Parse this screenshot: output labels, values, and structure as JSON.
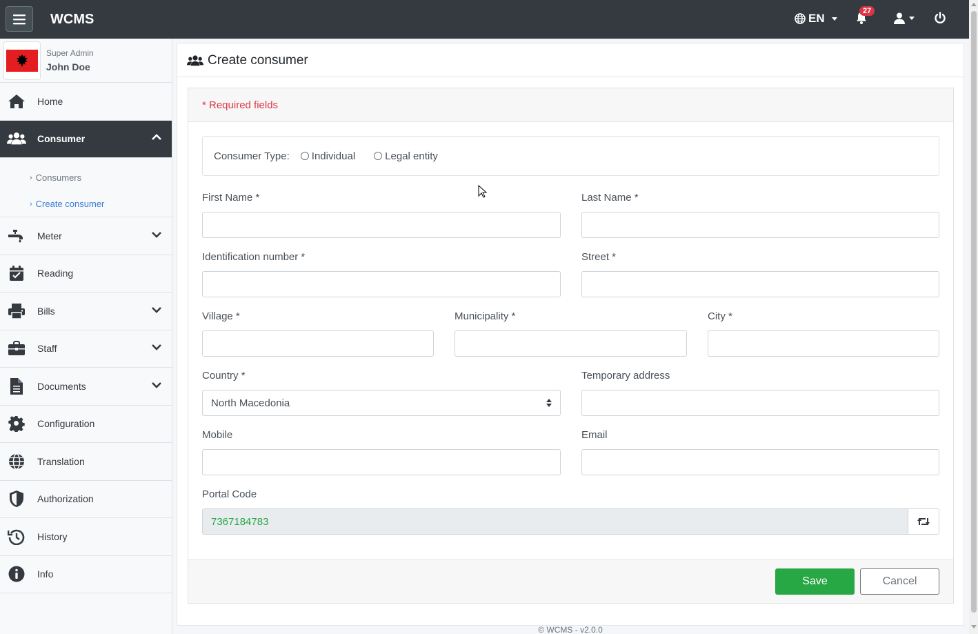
{
  "app": {
    "brand": "WCMS"
  },
  "navbar": {
    "language": "EN",
    "notifications_count": "27"
  },
  "user": {
    "role": "Super Admin",
    "name": "John Doe"
  },
  "sidebar": {
    "items": [
      {
        "label": "Home",
        "icon": "home-icon"
      },
      {
        "label": "Consumer",
        "icon": "users-icon",
        "active": true
      },
      {
        "label": "Meter",
        "icon": "faucet-icon"
      },
      {
        "label": "Reading",
        "icon": "calendar-check-icon"
      },
      {
        "label": "Bills",
        "icon": "printer-icon"
      },
      {
        "label": "Staff",
        "icon": "briefcase-icon"
      },
      {
        "label": "Documents",
        "icon": "document-icon"
      },
      {
        "label": "Configuration",
        "icon": "gear-icon"
      },
      {
        "label": "Translation",
        "icon": "globe-icon"
      },
      {
        "label": "Authorization",
        "icon": "shield-icon"
      },
      {
        "label": "History",
        "icon": "history-icon"
      },
      {
        "label": "Info",
        "icon": "info-icon"
      }
    ],
    "subitems": [
      {
        "label": "Consumers"
      },
      {
        "label": "Create consumer"
      }
    ]
  },
  "page": {
    "title": "Create consumer"
  },
  "form": {
    "required_note": "* Required fields",
    "consumer_type_label": "Consumer Type:",
    "type_individual": "Individual",
    "type_legal": "Legal entity",
    "first_name": "First Name *",
    "last_name": "Last Name *",
    "id_number": "Identification number *",
    "street": "Street *",
    "village": "Village *",
    "municipality": "Municipality *",
    "city": "City *",
    "country": "Country *",
    "country_value": "North Macedonia",
    "temp_address": "Temporary address",
    "mobile": "Mobile",
    "email": "Email",
    "portal_code": "Portal Code",
    "portal_code_value": "7367184783",
    "save": "Save",
    "cancel": "Cancel"
  },
  "footer": {
    "text": "© WCMS - v2.0.0"
  },
  "colors": {
    "navbar": "#343a40",
    "save": "#28a745",
    "required": "#dc3545",
    "link": "#3b7dd8"
  }
}
